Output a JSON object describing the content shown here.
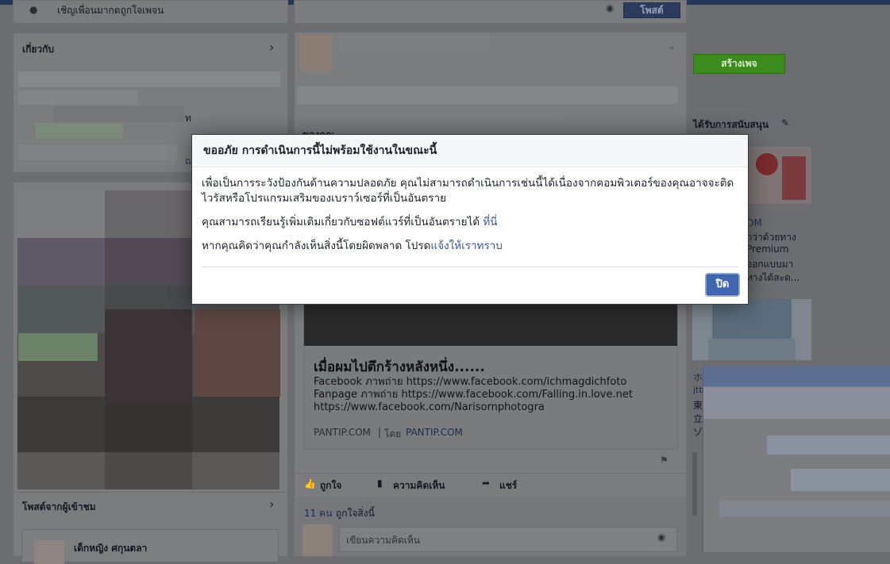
{
  "left_column": {
    "invite_text": "เชิญเพื่อนมากดถูกใจเพจน",
    "about_label": "เกี่ยวกับ",
    "about_char": "ท",
    "about_link": "ณ",
    "visitor_posts_label": "โพสต์จากผู้เข้าชม",
    "visitor_name": "เด็กหญิง ศกุนตลา"
  },
  "feed": {
    "top_button": "โพสต์",
    "partial_label": "ของคุณ",
    "post": {
      "link_title": "เมื่อผมไปตึกร้างหลังหนึ่ง......",
      "link_desc": "Facebook ภาพถ่าย https://www.facebook.com/ichmagdichfoto Fanpage ภาพถ่าย https://www.facebook.com/Falling.in.love.net https://www.facebook.com/Narisornphotogra",
      "source_domain": "PANTIP.COM",
      "source_by": "โดย",
      "source_name": "PANTIP.COM",
      "like_label": "ถูกใจ",
      "comment_label": "ความคิดเห็น",
      "share_label": "แชร์",
      "likes_count": "11 คน",
      "likes_text": "ถูกใจสิ่งนี้",
      "comment_placeholder": "เขียนความคิดเห็น"
    }
  },
  "right_column": {
    "create_page_button": "สร้างเพจ",
    "sponsored_label": "ได้รับการสนับสนุน",
    "ad1_domain": "OM",
    "ad1_line1": "กว่าด้วยทาง",
    "ad1_line2": "Premium",
    "ad1_line3": "ออกแบบมา",
    "ad1_line4": "ทางได้สะด...",
    "ad2_char1": "ホ",
    "ad2_char2": "jtb",
    "ad2_char3": "東",
    "ad2_char4": "立",
    "ad2_char5": "ゾ"
  },
  "dialog": {
    "title": "ขออภัย การดำเนินการนี้ไม่พร้อมใช้งานในขณะนี้",
    "message": "เพื่อเป็นการระวังป้องกันด้านความปลอดภัย คุณไม่สามารถดำเนินการเช่นนี้ได้เนื่องจากคอมพิวเตอร์ของคุณอาจจะติดไวรัสหรือโปรแกรมเสริมของเบราว์เซอร์ที่เป็นอันตราย",
    "learn_more_text": "คุณสามารถเรียนรู้เพิ่มเติมเกี่ยวกับซอฟต์แวร์ที่เป็นอันตรายได้",
    "learn_more_link": "ที่นี่",
    "mistake_text": "หากคุณคิดว่าคุณกำลังเห็นสิ่งนี้โดยผิดพลาด โปรด",
    "mistake_link": "แจ้งให้เราทราบ",
    "close_button": "ปิด"
  }
}
